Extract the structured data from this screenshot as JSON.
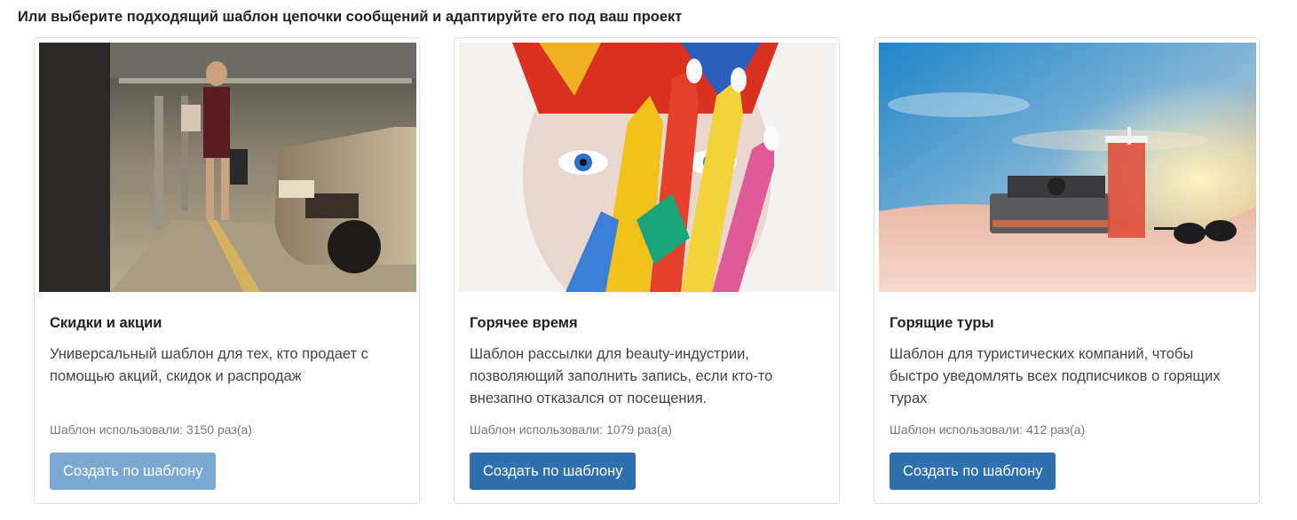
{
  "heading": "Или выберите подходящий шаблон цепочки сообщений и адаптируйте его под ваш проект",
  "cards": [
    {
      "title": "Скидки и акции",
      "description": "Универсальный шаблон для тех, кто продает с помощью акций, скидок и распродаж",
      "usage": "Шаблон использовали: 3150 раз(а)",
      "button_label": "Создать по шаблону",
      "image": "woman-shopping-parking-garage-photo"
    },
    {
      "title": "Горячее время",
      "description": "Шаблон рассылки для beauty-индустрии, позволяющий заполнить запись, если кто-то внезапно отказался от посещения.",
      "usage": "Шаблон использовали: 1079 раз(а)",
      "button_label": "Создать по шаблону",
      "image": "painted-face-hand-colorful-photo"
    },
    {
      "title": "Горящие туры",
      "description": "Шаблон для туристических компаний, чтобы быстро уведомлять всех подписчиков о горящих турах",
      "usage": "Шаблон использовали: 412 раз(а)",
      "button_label": "Создать по шаблону",
      "image": "beach-camera-sunset-photo"
    }
  ],
  "colors": {
    "button": "#2f6fad",
    "button_faded": "#7aa8d2",
    "border": "#dedede"
  }
}
